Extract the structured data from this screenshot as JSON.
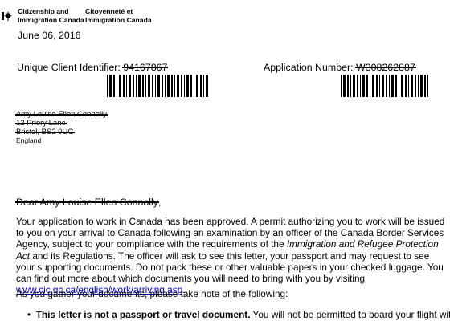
{
  "header": {
    "dept_en_line1": "Citizenship and",
    "dept_en_line2": "Immigration Canada",
    "dept_fr_line1": "Citoyenneté et",
    "dept_fr_line2": "Immigration Canada",
    "flag_color": "#000000"
  },
  "letter": {
    "date": "June 06, 2016",
    "uci_label": "Unique Client Identifier:",
    "uci_value": "94167867",
    "app_label": "Application Number:",
    "app_value": "W308262887"
  },
  "address": {
    "name": "Amy Louise Ellen Connolly",
    "street": "12 Priory Lane",
    "city": "Bristol, BS2 0UG",
    "country": "England"
  },
  "salutation": {
    "prefix": "Dear Amy Louise Ellen Connolly",
    "suffix": ","
  },
  "body": {
    "p1_a": "Your application to work in Canada has been approved. A permit authorizing you to work will be issued to you on your arrival to Canada following an examination by an officer of the Canada Border Services Agency, subject to your compliance with the requirements of the ",
    "p1_italic": "Immigration and Refugee Protection Act",
    "p1_b": " and its Regulations. The officer will ask to see this letter, your passport and may request to see your supporting documents.  Do not pack these or other valuable papers in your checked luggage. You can find out more about which documents you will need to bring with you by visiting ",
    "p1_link": "www.cic.gc.ca/english/work/arriving.asp",
    "p1_end": ".",
    "gather": "As you gather your documents, please take note of the following:",
    "bullet_bold": "This letter is not a passport or travel document.",
    "bullet_rest": " You will not be permitted to board your flight without"
  }
}
